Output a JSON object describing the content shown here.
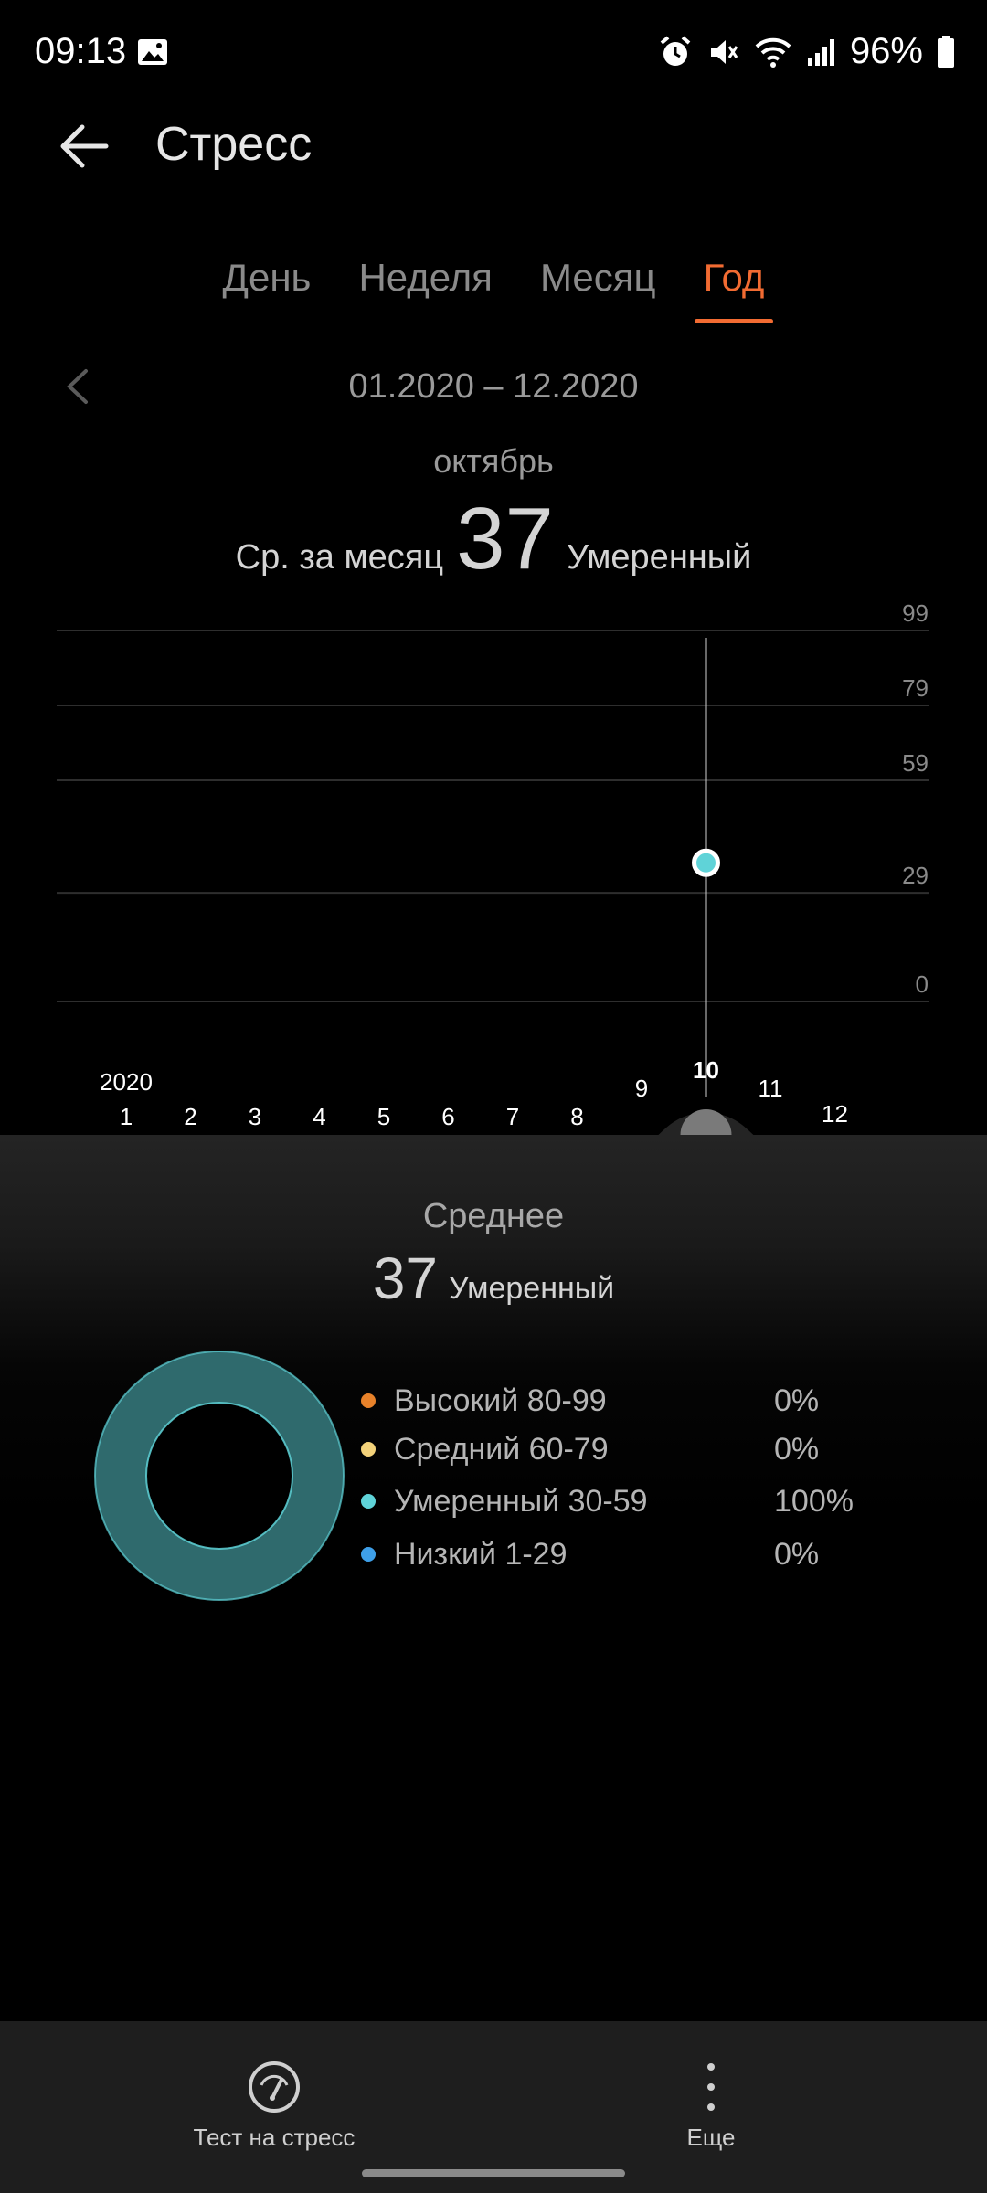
{
  "status_bar": {
    "time": "09:13",
    "battery": "96%",
    "icons": [
      "gallery-icon",
      "alarm-icon",
      "mute-icon",
      "wifi-icon",
      "signal-icon",
      "battery-icon"
    ]
  },
  "header": {
    "title": "Стресс"
  },
  "tabs": [
    {
      "label": "День",
      "active": false
    },
    {
      "label": "Неделя",
      "active": false
    },
    {
      "label": "Месяц",
      "active": false
    },
    {
      "label": "Год",
      "active": true
    }
  ],
  "period": {
    "range": "01.2020 – 12.2020",
    "selected_month": "октябрь",
    "avg_label": "Ср. за месяц",
    "avg_value": "37",
    "avg_level": "Умеренный"
  },
  "chart_data": {
    "type": "line",
    "y_ticks": [
      99,
      79,
      59,
      29,
      0
    ],
    "ylim": [
      0,
      99
    ],
    "year_label": "2020",
    "x": [
      1,
      2,
      3,
      4,
      5,
      6,
      7,
      8,
      9,
      10,
      11,
      12
    ],
    "series": [
      {
        "values": [
          null,
          null,
          null,
          null,
          null,
          null,
          null,
          null,
          null,
          37,
          null,
          null
        ]
      }
    ],
    "selected_x": 10,
    "grid": true,
    "colors": {
      "point": "#5fd3d8",
      "grid": "#2e2e2e",
      "axis_text": "#8a8a8a"
    }
  },
  "summary": {
    "title": "Среднее",
    "value": "37",
    "level": "Умеренный",
    "legend": [
      {
        "label": "Высокий 80-99",
        "percent": "0%",
        "color": "#e8822a",
        "share": 0
      },
      {
        "label": "Средний 60-79",
        "percent": "0%",
        "color": "#f3d27a",
        "share": 0
      },
      {
        "label": "Умеренный 30-59",
        "percent": "100%",
        "color": "#5fd3d8",
        "share": 1
      },
      {
        "label": "Низкий 1-29",
        "percent": "0%",
        "color": "#3e9fe8",
        "share": 0
      }
    ]
  },
  "bottom_nav": {
    "stress_test_label": "Тест на стресс",
    "more_label": "Еще"
  },
  "colors": {
    "accent": "#f26b32",
    "moderate": "#5fd3d8",
    "donut_fill": "#2f6a6d"
  }
}
